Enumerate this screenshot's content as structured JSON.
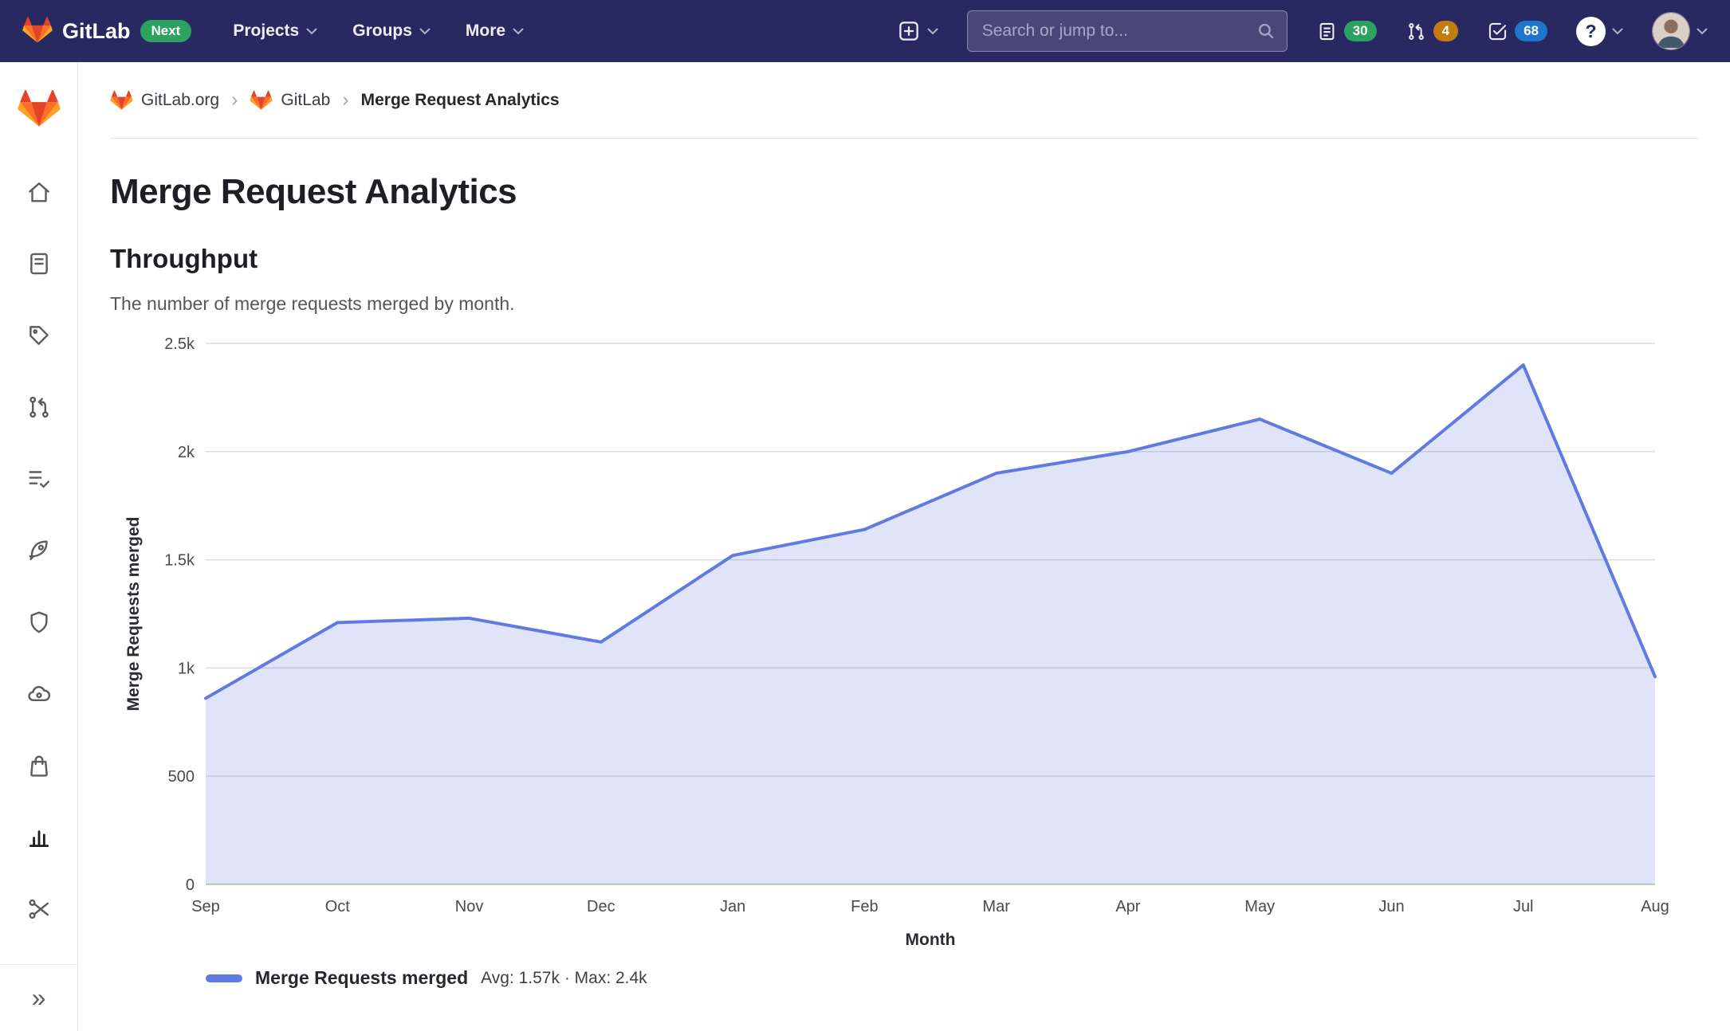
{
  "navbar": {
    "brand": "GitLab",
    "next_badge": "Next",
    "menus": [
      {
        "label": "Projects"
      },
      {
        "label": "Groups"
      },
      {
        "label": "More"
      }
    ],
    "search": {
      "placeholder": "Search or jump to..."
    },
    "badges": {
      "issues": "30",
      "merge_requests": "4",
      "todos": "68"
    },
    "icons": [
      "gitlab-logo",
      "plus-square-icon",
      "chevron-down-icon",
      "search-icon",
      "issues-icon",
      "merge-request-icon",
      "todos-icon",
      "help-icon",
      "avatar"
    ]
  },
  "sidebar": {
    "icons": [
      "gitlab-project-logo",
      "home-icon",
      "repository-icon",
      "issues-icon",
      "merge-request-icon",
      "requirements-icon",
      "ci-cd-rocket-icon",
      "security-shield-icon",
      "operations-icon",
      "packages-bag-icon",
      "analytics-chart-icon",
      "snippets-scissors-icon"
    ],
    "collapse_glyph": "»"
  },
  "breadcrumb": {
    "separator": "›",
    "items": [
      {
        "label": "GitLab.org"
      },
      {
        "label": "GitLab"
      },
      {
        "label": "Merge Request Analytics"
      }
    ]
  },
  "page": {
    "title": "Merge Request Analytics",
    "section_title": "Throughput",
    "description": "The number of merge requests merged by month."
  },
  "chart_data": {
    "type": "area",
    "title": "Throughput",
    "x": [
      "Sep",
      "Oct",
      "Nov",
      "Dec",
      "Jan",
      "Feb",
      "Mar",
      "Apr",
      "May",
      "Jun",
      "Jul",
      "Aug"
    ],
    "series": [
      {
        "name": "Merge Requests merged",
        "values": [
          860,
          1210,
          1230,
          1120,
          1520,
          1640,
          1900,
          2000,
          2150,
          1900,
          2400,
          960
        ]
      }
    ],
    "xlabel": "Month",
    "ylabel": "Merge Requests merged",
    "ylim": [
      0,
      2500
    ],
    "yticks": [
      0,
      500,
      1000,
      1500,
      2000,
      2500
    ],
    "ytick_labels": [
      "0",
      "500",
      "1k",
      "1.5k",
      "2k",
      "2.5k"
    ],
    "grid": true,
    "legend_position": "bottom-left",
    "line_color": "#617ae2",
    "fill_opacity": 0.2,
    "legend": {
      "label": "Merge Requests merged",
      "stats": "Avg: 1.57k · Max: 2.4k"
    }
  }
}
